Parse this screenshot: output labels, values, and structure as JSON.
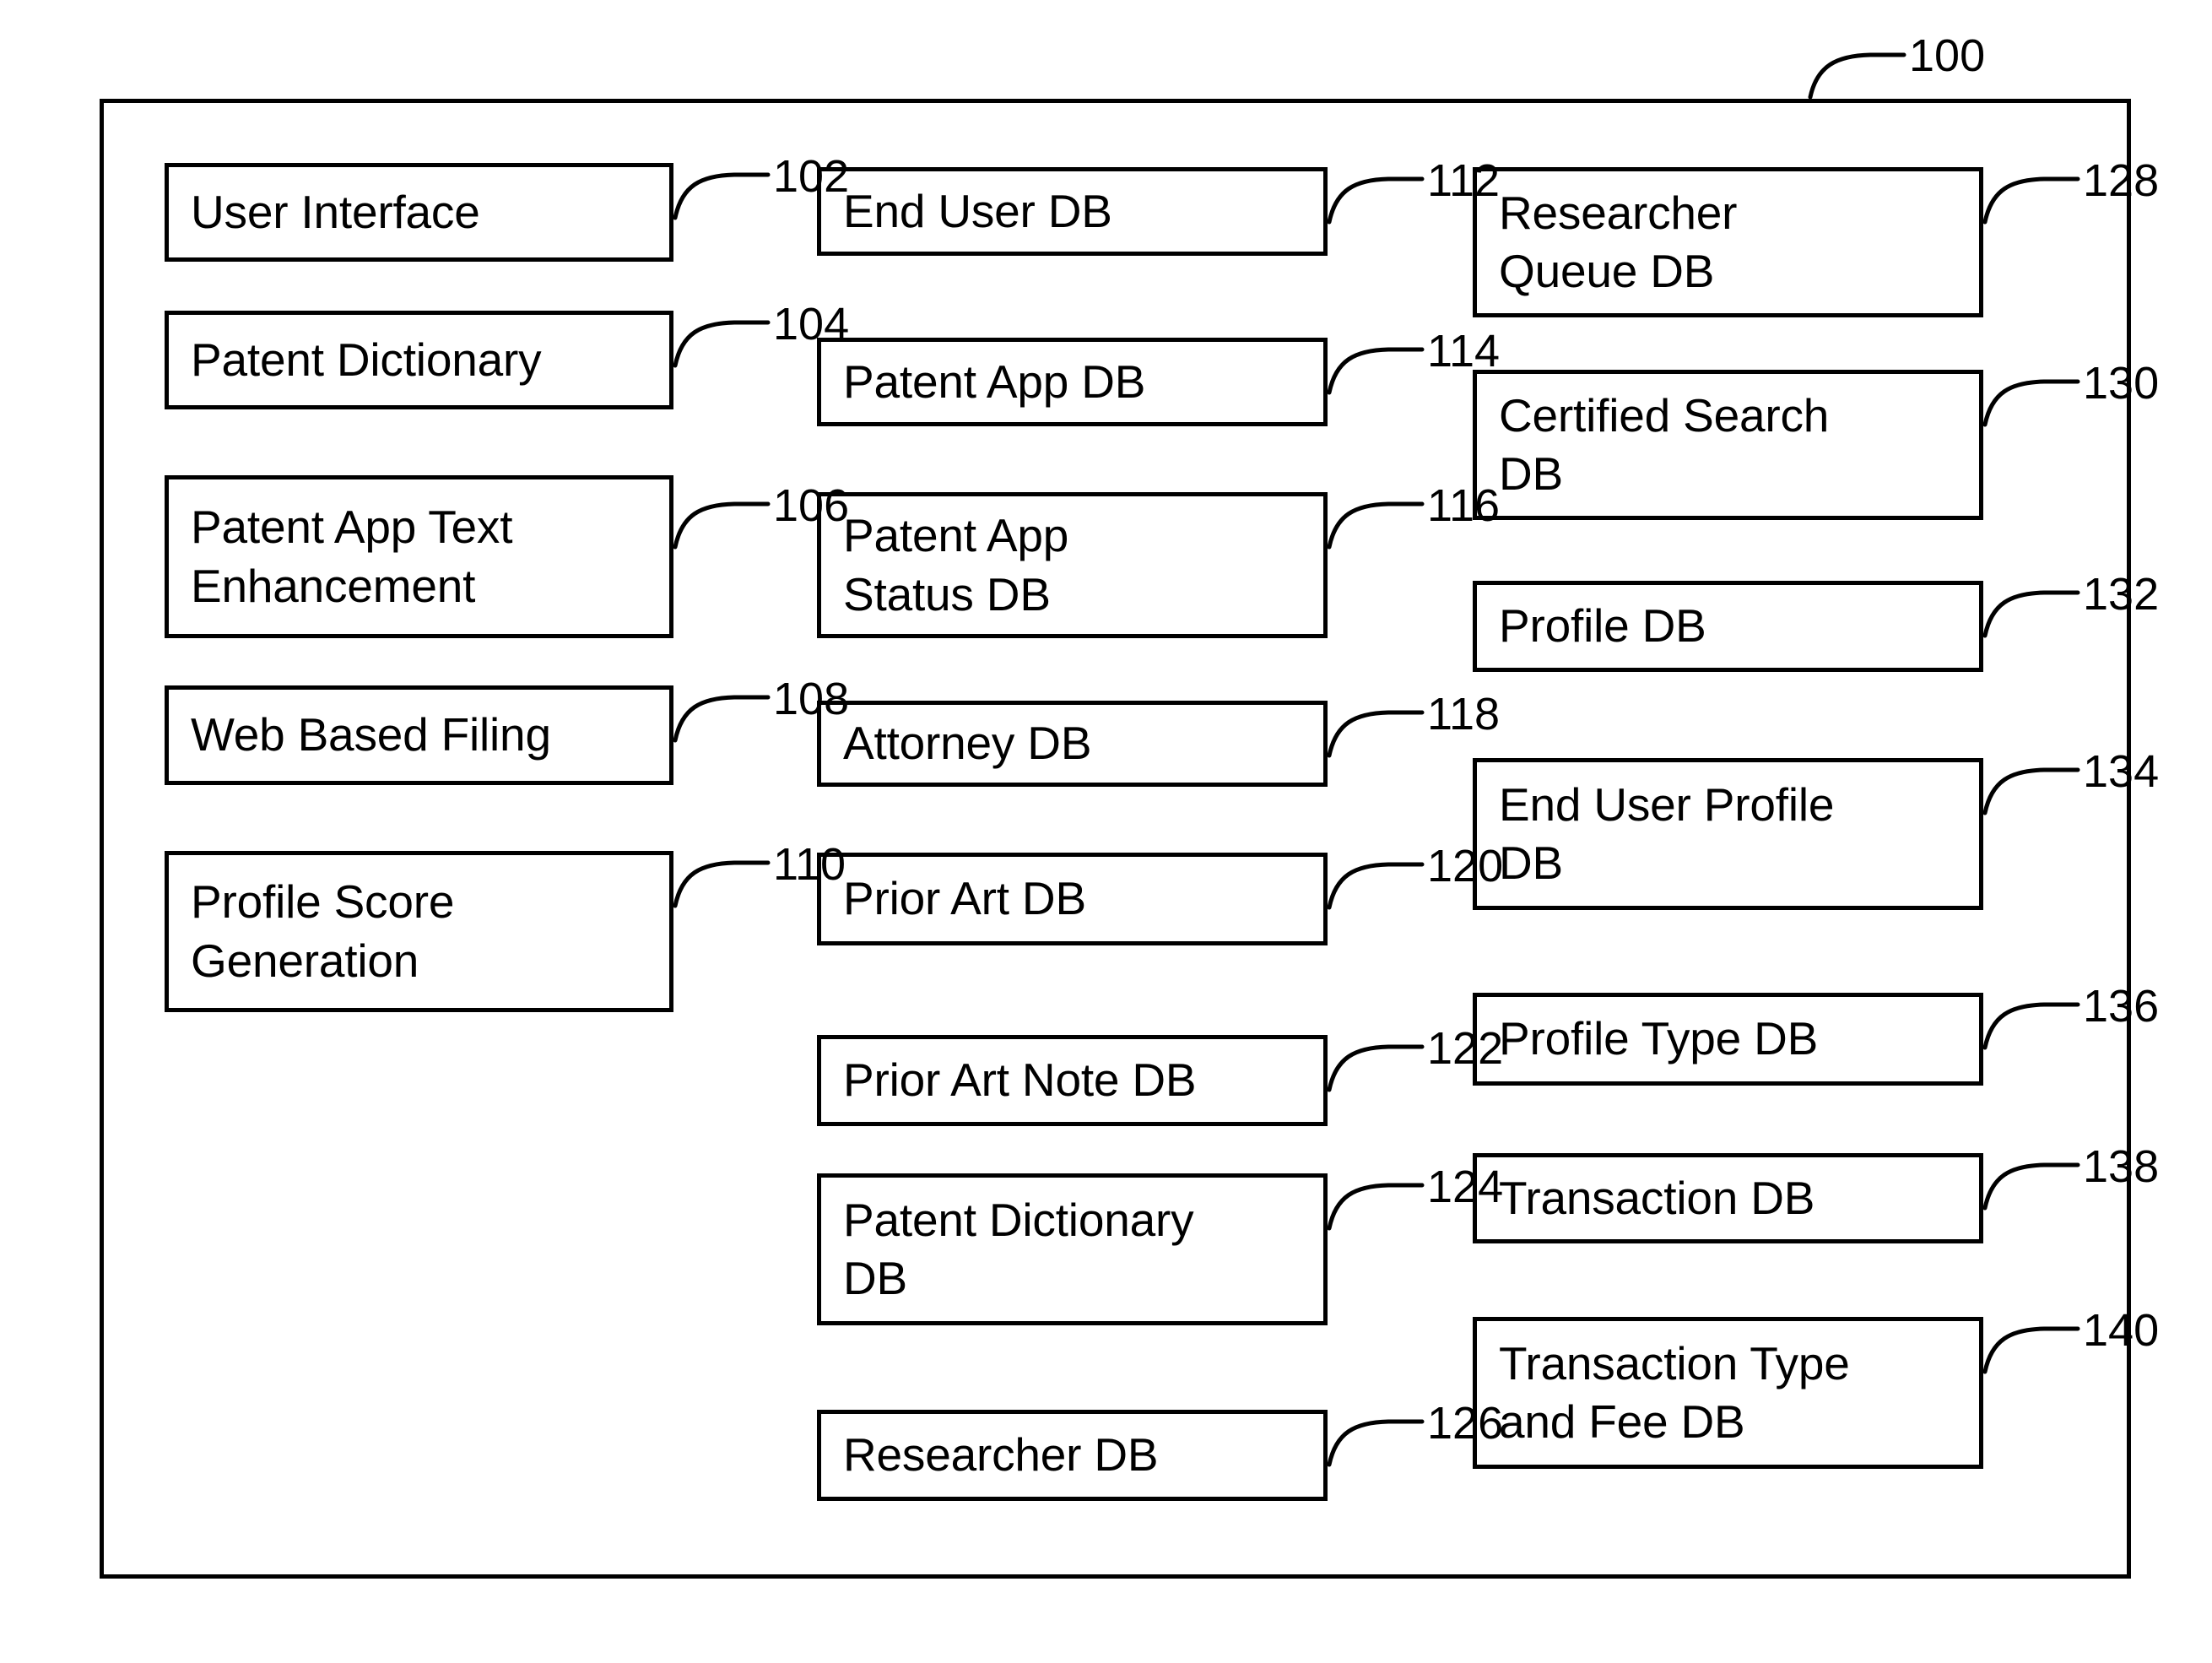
{
  "figure": {
    "system_ref": "100",
    "frame_name": "system-boundary"
  },
  "columns": {
    "left": {
      "name": "modules-column",
      "boxes": [
        {
          "ref": "102",
          "label": "User Interface"
        },
        {
          "ref": "104",
          "label": "Patent Dictionary"
        },
        {
          "ref": "106",
          "label": "Patent App Text\nEnhancement"
        },
        {
          "ref": "108",
          "label": "Web Based Filing"
        },
        {
          "ref": "110",
          "label": "Profile Score\nGeneration"
        }
      ]
    },
    "middle": {
      "name": "databases-column-one",
      "boxes": [
        {
          "ref": "112",
          "label": "End User DB"
        },
        {
          "ref": "114",
          "label": "Patent App DB"
        },
        {
          "ref": "116",
          "label": "Patent App\nStatus DB"
        },
        {
          "ref": "118",
          "label": "Attorney DB"
        },
        {
          "ref": "120",
          "label": "Prior Art DB"
        },
        {
          "ref": "122",
          "label": "Prior Art Note DB"
        },
        {
          "ref": "124",
          "label": "Patent Dictionary\nDB"
        },
        {
          "ref": "126",
          "label": "Researcher DB"
        }
      ]
    },
    "right": {
      "name": "databases-column-two",
      "boxes": [
        {
          "ref": "128",
          "label": "Researcher\nQueue DB"
        },
        {
          "ref": "130",
          "label": "Certified Search\nDB"
        },
        {
          "ref": "132",
          "label": "Profile DB"
        },
        {
          "ref": "134",
          "label": "End User Profile\nDB"
        },
        {
          "ref": "136",
          "label": "Profile Type DB"
        },
        {
          "ref": "138",
          "label": "Transaction DB"
        },
        {
          "ref": "140",
          "label": "Transaction Type\nand Fee DB"
        }
      ]
    }
  },
  "colors": {
    "stroke": "#000000",
    "background": "#ffffff"
  }
}
